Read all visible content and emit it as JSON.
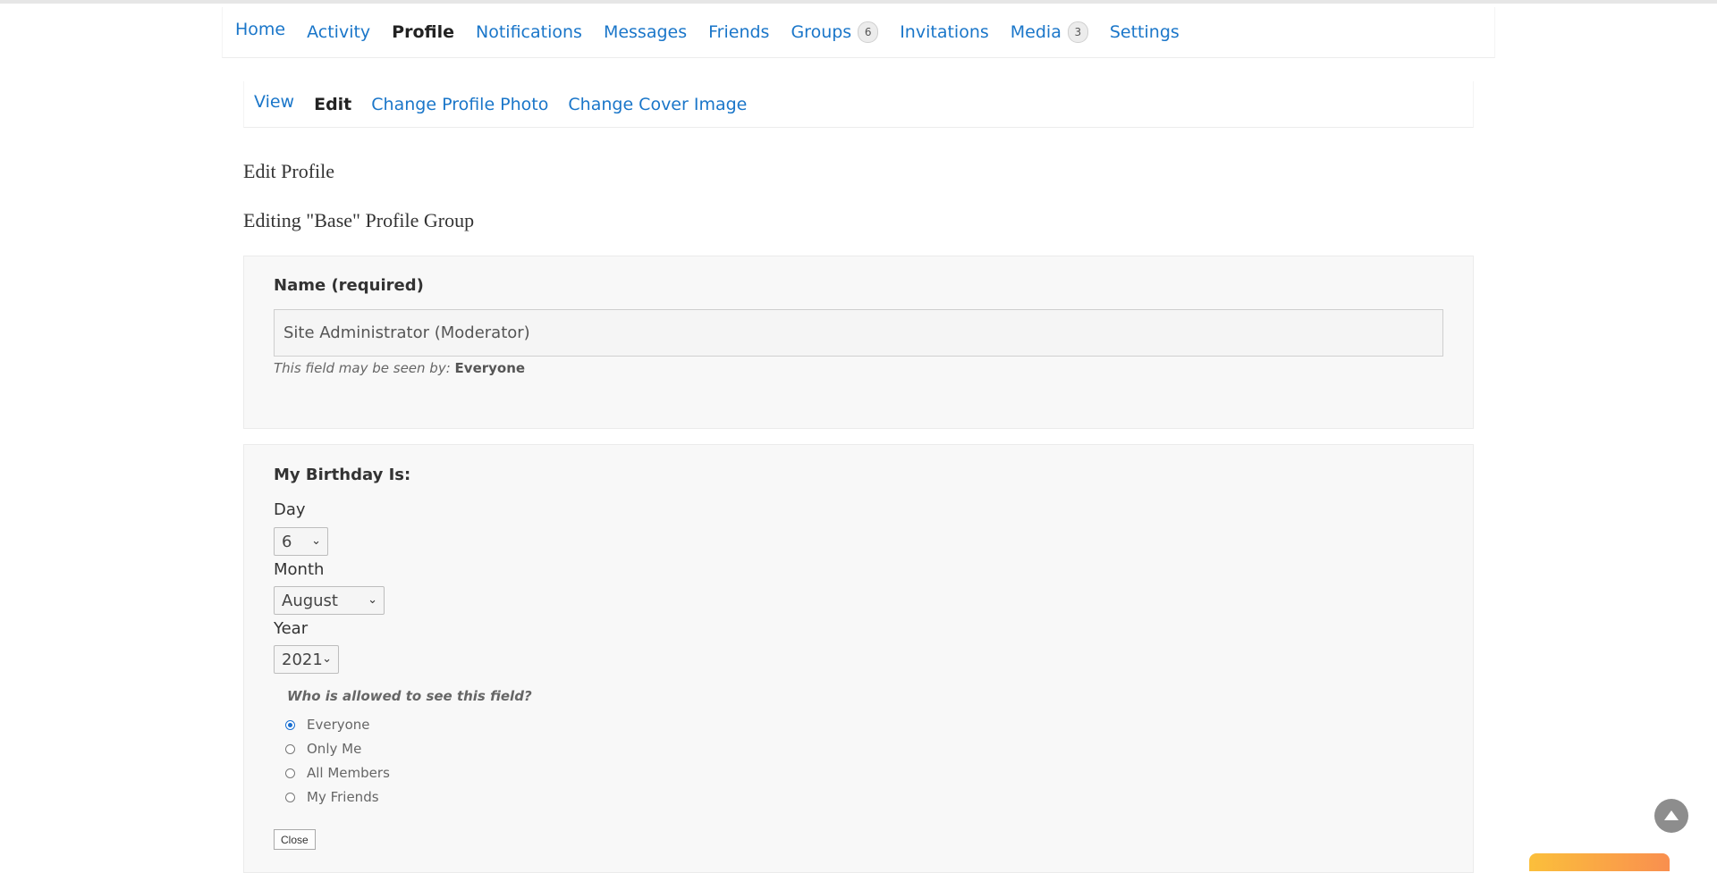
{
  "main_nav": [
    {
      "label": "Home"
    },
    {
      "label": "Activity"
    },
    {
      "label": "Profile",
      "current": true
    },
    {
      "label": "Notifications"
    },
    {
      "label": "Messages"
    },
    {
      "label": "Friends"
    },
    {
      "label": "Groups",
      "count": "6"
    },
    {
      "label": "Invitations"
    },
    {
      "label": "Media",
      "count": "3"
    },
    {
      "label": "Settings"
    }
  ],
  "sub_nav": [
    {
      "label": "View"
    },
    {
      "label": "Edit",
      "current": true
    },
    {
      "label": "Change Profile Photo"
    },
    {
      "label": "Change Cover Image"
    }
  ],
  "page": {
    "title": "Edit Profile",
    "group_title": "Editing \"Base\" Profile Group"
  },
  "name_field": {
    "label": "Name (required)",
    "value": "Site Administrator (Moderator)",
    "visibility_prefix": "This field may be seen by:",
    "visibility_value": "Everyone"
  },
  "birthday_field": {
    "label": "My Birthday Is:",
    "day_label": "Day",
    "day_value": "6",
    "month_label": "Month",
    "month_value": "August",
    "year_label": "Year",
    "year_value": "2021",
    "visibility_question": "Who is allowed to see this field?",
    "visibility_options": [
      "Everyone",
      "Only Me",
      "All Members",
      "My Friends"
    ],
    "visibility_selected": "Everyone",
    "close_label": "Close"
  },
  "icons": {
    "back_to_top": "arrow-up-icon",
    "select_chevron": "chevron-down-icon"
  },
  "colors": {
    "link": "#1a76c9",
    "radio_accent": "#1a6fd1"
  }
}
